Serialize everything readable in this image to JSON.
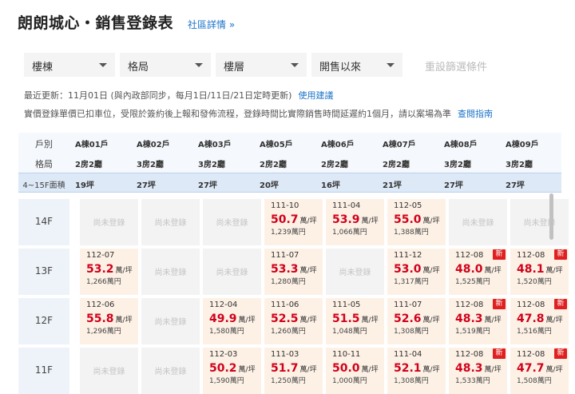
{
  "header": {
    "title": "朗朗城心・銷售登錄表",
    "link": "社區詳情 »"
  },
  "filters": [
    {
      "label": "樓棟"
    },
    {
      "label": "格局"
    },
    {
      "label": "樓層"
    },
    {
      "label": "開售以來"
    }
  ],
  "reset_label": "重設篩選條件",
  "info": {
    "line1": "最近更新：11月01日 (與內政部同步，每月1日/11日/21日定時更新)",
    "line1_link": "使用建議",
    "line2": "實價登錄單價已扣車位，受限於簽約後上報和發佈流程，登錄時間比實際銷售時間延遲約1個月，請以案場為準",
    "line2_link": "查閱指南"
  },
  "table": {
    "row_labels": {
      "unit": "戶別",
      "layout": "格局",
      "area": "4~15F面積"
    },
    "units": [
      {
        "name": "A棟01戶",
        "layout": "2房2廳",
        "area": "19坪"
      },
      {
        "name": "A棟02戶",
        "layout": "3房2廳",
        "area": "27坪"
      },
      {
        "name": "A棟03戶",
        "layout": "3房2廳",
        "area": "27坪"
      },
      {
        "name": "A棟05戶",
        "layout": "2房2廳",
        "area": "20坪"
      },
      {
        "name": "A棟06戶",
        "layout": "2房2廳",
        "area": "16坪"
      },
      {
        "name": "A棟07戶",
        "layout": "2房2廳",
        "area": "21坪"
      },
      {
        "name": "A棟08戶",
        "layout": "3房2廳",
        "area": "27坪"
      },
      {
        "name": "A棟09戶",
        "layout": "3房2廳",
        "area": "27坪"
      }
    ],
    "empty_label": "尚未登錄",
    "new_badge": "新",
    "price_unit": "萬/坪",
    "floors": [
      {
        "floor": "14F",
        "cells": [
          null,
          null,
          null,
          {
            "date": "111-10",
            "price": "50.7",
            "total": "1,239萬円"
          },
          {
            "date": "111-04",
            "price": "53.9",
            "total": "1,066萬円"
          },
          {
            "date": "112-05",
            "price": "55.0",
            "total": "1,388萬円"
          },
          null,
          null
        ]
      },
      {
        "floor": "13F",
        "cells": [
          {
            "date": "112-07",
            "price": "53.2",
            "total": "1,266萬円"
          },
          null,
          null,
          {
            "date": "111-07",
            "price": "53.3",
            "total": "1,280萬円"
          },
          null,
          {
            "date": "111-12",
            "price": "53.0",
            "total": "1,317萬円"
          },
          {
            "date": "112-08",
            "price": "48.0",
            "total": "1,525萬円",
            "new": true
          },
          {
            "date": "112-08",
            "price": "48.1",
            "total": "1,520萬円",
            "new": true
          }
        ]
      },
      {
        "floor": "12F",
        "cells": [
          {
            "date": "112-06",
            "price": "55.8",
            "total": "1,296萬円"
          },
          null,
          {
            "date": "112-04",
            "price": "49.9",
            "total": "1,580萬円"
          },
          {
            "date": "111-06",
            "price": "52.5",
            "total": "1,260萬円"
          },
          {
            "date": "111-05",
            "price": "51.5",
            "total": "1,048萬円"
          },
          {
            "date": "111-07",
            "price": "52.6",
            "total": "1,308萬円"
          },
          {
            "date": "112-08",
            "price": "48.3",
            "total": "1,519萬円",
            "new": true
          },
          {
            "date": "112-08",
            "price": "47.8",
            "total": "1,516萬円",
            "new": true
          }
        ]
      },
      {
        "floor": "11F",
        "cells": [
          null,
          null,
          {
            "date": "112-03",
            "price": "50.2",
            "total": "1,590萬円"
          },
          {
            "date": "111-03",
            "price": "51.7",
            "total": "1,250萬円"
          },
          {
            "date": "110-11",
            "price": "50.0",
            "total": "1,000萬円"
          },
          {
            "date": "111-04",
            "price": "52.1",
            "total": "1,308萬円"
          },
          {
            "date": "112-08",
            "price": "48.3",
            "total": "1,533萬円",
            "new": true
          },
          {
            "date": "112-08",
            "price": "47.7",
            "total": "1,508萬円",
            "new": true
          }
        ]
      }
    ]
  },
  "colors": {
    "accent": "#1a73c8",
    "price": "#d0021b",
    "sold_bg": "#fdf1e6",
    "badge": "#e02020"
  }
}
